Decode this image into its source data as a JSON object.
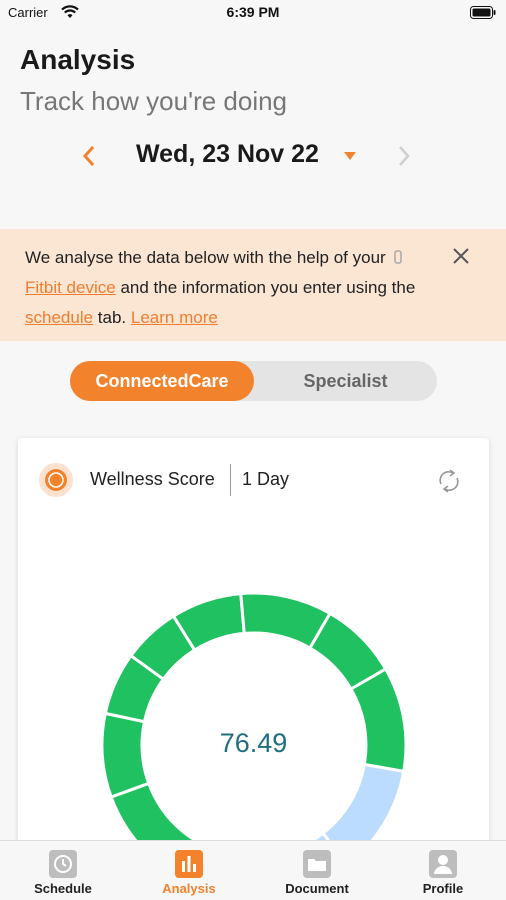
{
  "status": {
    "carrier": "Carrier",
    "time": "6:39 PM"
  },
  "header": {
    "title": "Analysis",
    "subtitle": "Track how you're doing",
    "date": "Wed, 23 Nov 22"
  },
  "banner": {
    "text_1": "We analyse the data below with the help of your",
    "device_link": "Fitbit device",
    "text_2": "and the information you enter using the",
    "schedule_link": "schedule",
    "text_3": "tab.",
    "learn_more": "Learn more"
  },
  "segments": {
    "active": "ConnectedCare",
    "inactive": "Specialist"
  },
  "card": {
    "title": "Wellness Score",
    "period": "1 Day",
    "score": "76.49",
    "score_value": 76.49
  },
  "tabs": [
    {
      "label": "Schedule",
      "icon": "clock-icon"
    },
    {
      "label": "Analysis",
      "icon": "bar-chart-icon"
    },
    {
      "label": "Document",
      "icon": "folder-icon"
    },
    {
      "label": "Profile",
      "icon": "person-icon"
    }
  ],
  "colors": {
    "accent": "#f3822d",
    "gauge_green": "#1fc160",
    "gauge_blue": "#bcdcff",
    "gauge_yellow": "#f6c411",
    "score_text": "#1f6f7f"
  }
}
